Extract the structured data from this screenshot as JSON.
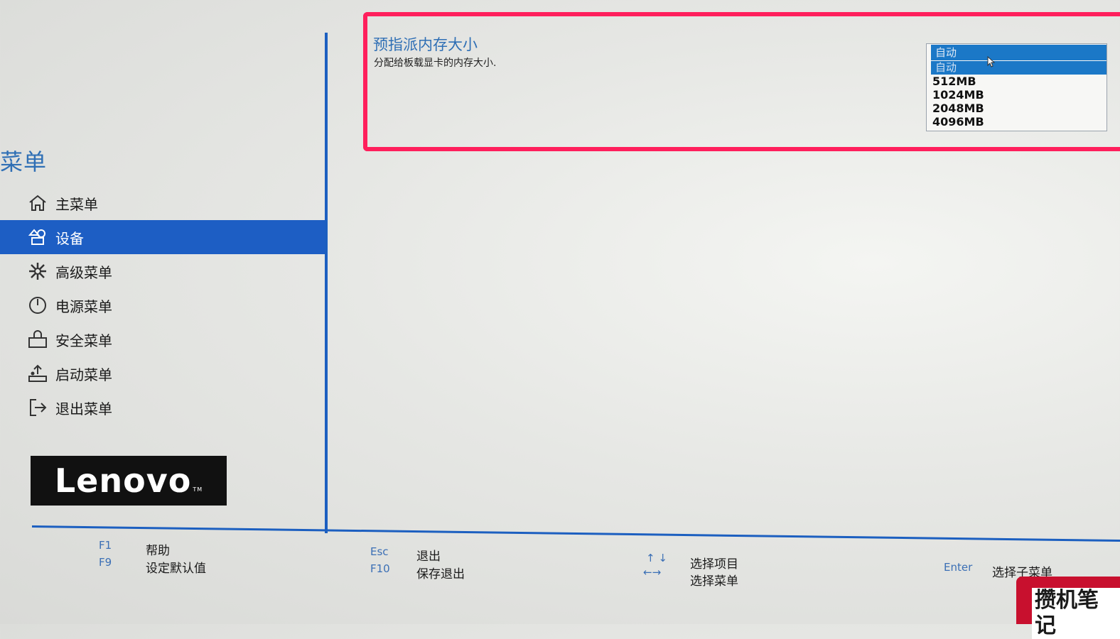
{
  "sidebar": {
    "heading": "菜单",
    "items": [
      {
        "label": "主菜单",
        "icon": "home-icon"
      },
      {
        "label": "设备",
        "icon": "devices-icon",
        "active": true
      },
      {
        "label": "高级菜单",
        "icon": "advanced-icon"
      },
      {
        "label": "电源菜单",
        "icon": "power-icon"
      },
      {
        "label": "安全菜单",
        "icon": "security-icon"
      },
      {
        "label": "启动菜单",
        "icon": "boot-icon"
      },
      {
        "label": "退出菜单",
        "icon": "exit-icon"
      }
    ],
    "logo": "Lenovo"
  },
  "setting": {
    "title": "预指派内存大小",
    "description": "分配给板载显卡的内存大小."
  },
  "dropdown": {
    "current_value": "自动",
    "options": [
      "自动",
      "512MB",
      "1024MB",
      "2048MB",
      "4096MB"
    ],
    "selected_option": "自动"
  },
  "footer": {
    "f1_key": "F1",
    "f1_label": "帮助",
    "f9_key": "F9",
    "f9_label": "设定默认值",
    "esc_key": "Esc",
    "esc_label": "退出",
    "f10_key": "F10",
    "f10_label": "保存退出",
    "updown_key": "↑ ↓",
    "updown_label": "选择项目",
    "leftright_key": "←→",
    "leftright_label": "选择菜单",
    "enter_key": "Enter",
    "enter_label": "选择子菜单"
  },
  "watermark": {
    "text": "攒机笔记",
    "url": "www.cuanjibiji.com"
  },
  "colors": {
    "accent_blue": "#1d5ec4",
    "highlight_pink": "#ff1f5c",
    "dropdown_blue": "#1b78c7",
    "background": "#e6e7e4"
  }
}
